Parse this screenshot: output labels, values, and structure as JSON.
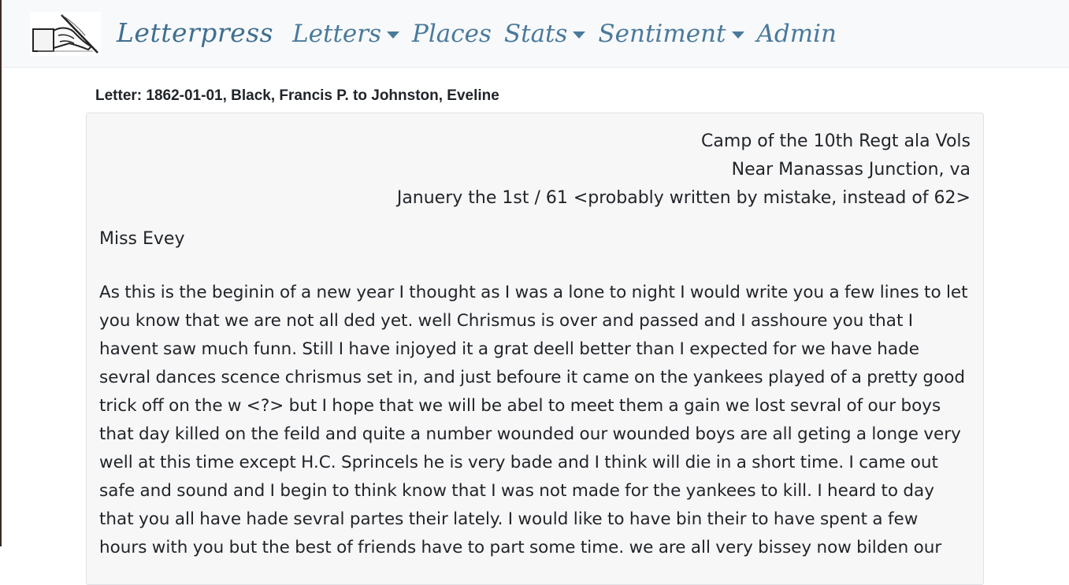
{
  "navbar": {
    "brand": "Letterpress",
    "logo_icon": "quill-hand-icon",
    "items": [
      {
        "label": "Letters",
        "dropdown": true
      },
      {
        "label": "Places",
        "dropdown": false
      },
      {
        "label": "Stats",
        "dropdown": true
      },
      {
        "label": "Sentiment",
        "dropdown": true
      },
      {
        "label": "Admin",
        "dropdown": false
      }
    ]
  },
  "letter": {
    "heading": "Letter: 1862-01-01, Black, Francis P. to Johnston, Eveline",
    "address_lines": [
      "Camp of the 10th Regt ala Vols",
      "Near Manassas Junction, va",
      "Januery the 1st / 61 <probably written by mistake, instead of 62>"
    ],
    "salutation": "Miss Evey",
    "body": "As this is the beginin of a new year I thought as I was a lone to night I would write you a few lines to let you know that we are not all ded yet. well Chrismus is over and passed and I asshoure you that I havent saw much funn. Still I have injoyed it a grat deell better than I expected for we have hade sevral dances scence chrismus set in, and just befoure it came on the yankees played of a pretty good trick off on the w <?> but I hope that we will be abel to meet them a gain we lost sevral of our boys that day killed on the feild and quite a number wounded our wounded boys are all geting a longe very well at this time except H.C. Sprincels he is very bade and I think will die in a short time. I came out safe and sound and I begin to think know that I was not made for the yankees to kill. I heard to day that you all have hade sevral partes their lately. I would like to have bin their to have spent a few hours with you but the best of friends have to part some time. we are all very bissey now bilden our"
  }
}
